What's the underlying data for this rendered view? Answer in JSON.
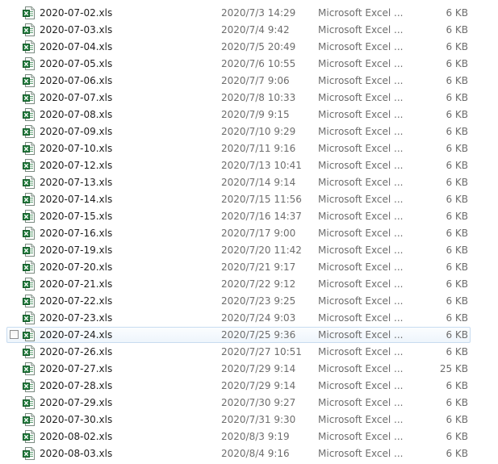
{
  "icons": {
    "file_icon": "excel-xls-icon",
    "checkbox": "checkbox-icon"
  },
  "colors": {
    "hover_border": "#c8dcf0",
    "excel_green": "#1f7a3a",
    "meta_text": "#6d6d6d"
  },
  "hovered_row_index": 19,
  "files": [
    {
      "name": "2020-07-02.xls",
      "modified": "2020/7/3 14:29",
      "type": "Microsoft Excel ...",
      "size": "6 KB"
    },
    {
      "name": "2020-07-03.xls",
      "modified": "2020/7/4 9:42",
      "type": "Microsoft Excel ...",
      "size": "6 KB"
    },
    {
      "name": "2020-07-04.xls",
      "modified": "2020/7/5 20:49",
      "type": "Microsoft Excel ...",
      "size": "6 KB"
    },
    {
      "name": "2020-07-05.xls",
      "modified": "2020/7/6 10:55",
      "type": "Microsoft Excel ...",
      "size": "6 KB"
    },
    {
      "name": "2020-07-06.xls",
      "modified": "2020/7/7 9:06",
      "type": "Microsoft Excel ...",
      "size": "6 KB"
    },
    {
      "name": "2020-07-07.xls",
      "modified": "2020/7/8 10:33",
      "type": "Microsoft Excel ...",
      "size": "6 KB"
    },
    {
      "name": "2020-07-08.xls",
      "modified": "2020/7/9 9:15",
      "type": "Microsoft Excel ...",
      "size": "6 KB"
    },
    {
      "name": "2020-07-09.xls",
      "modified": "2020/7/10 9:29",
      "type": "Microsoft Excel ...",
      "size": "6 KB"
    },
    {
      "name": "2020-07-10.xls",
      "modified": "2020/7/11 9:16",
      "type": "Microsoft Excel ...",
      "size": "6 KB"
    },
    {
      "name": "2020-07-12.xls",
      "modified": "2020/7/13 10:41",
      "type": "Microsoft Excel ...",
      "size": "6 KB"
    },
    {
      "name": "2020-07-13.xls",
      "modified": "2020/7/14 9:14",
      "type": "Microsoft Excel ...",
      "size": "6 KB"
    },
    {
      "name": "2020-07-14.xls",
      "modified": "2020/7/15 11:56",
      "type": "Microsoft Excel ...",
      "size": "6 KB"
    },
    {
      "name": "2020-07-15.xls",
      "modified": "2020/7/16 14:37",
      "type": "Microsoft Excel ...",
      "size": "6 KB"
    },
    {
      "name": "2020-07-16.xls",
      "modified": "2020/7/17 9:00",
      "type": "Microsoft Excel ...",
      "size": "6 KB"
    },
    {
      "name": "2020-07-19.xls",
      "modified": "2020/7/20 11:42",
      "type": "Microsoft Excel ...",
      "size": "6 KB"
    },
    {
      "name": "2020-07-20.xls",
      "modified": "2020/7/21 9:17",
      "type": "Microsoft Excel ...",
      "size": "6 KB"
    },
    {
      "name": "2020-07-21.xls",
      "modified": "2020/7/22 9:12",
      "type": "Microsoft Excel ...",
      "size": "6 KB"
    },
    {
      "name": "2020-07-22.xls",
      "modified": "2020/7/23 9:25",
      "type": "Microsoft Excel ...",
      "size": "6 KB"
    },
    {
      "name": "2020-07-23.xls",
      "modified": "2020/7/24 9:03",
      "type": "Microsoft Excel ...",
      "size": "6 KB"
    },
    {
      "name": "2020-07-24.xls",
      "modified": "2020/7/25 9:36",
      "type": "Microsoft Excel ...",
      "size": "6 KB"
    },
    {
      "name": "2020-07-26.xls",
      "modified": "2020/7/27 10:51",
      "type": "Microsoft Excel ...",
      "size": "6 KB"
    },
    {
      "name": "2020-07-27.xls",
      "modified": "2020/7/29 9:14",
      "type": "Microsoft Excel ...",
      "size": "25 KB"
    },
    {
      "name": "2020-07-28.xls",
      "modified": "2020/7/29 9:14",
      "type": "Microsoft Excel ...",
      "size": "6 KB"
    },
    {
      "name": "2020-07-29.xls",
      "modified": "2020/7/30 9:27",
      "type": "Microsoft Excel ...",
      "size": "6 KB"
    },
    {
      "name": "2020-07-30.xls",
      "modified": "2020/7/31 9:30",
      "type": "Microsoft Excel ...",
      "size": "6 KB"
    },
    {
      "name": "2020-08-02.xls",
      "modified": "2020/8/3 9:19",
      "type": "Microsoft Excel ...",
      "size": "6 KB"
    },
    {
      "name": "2020-08-03.xls",
      "modified": "2020/8/4 9:16",
      "type": "Microsoft Excel ...",
      "size": "6 KB"
    }
  ]
}
